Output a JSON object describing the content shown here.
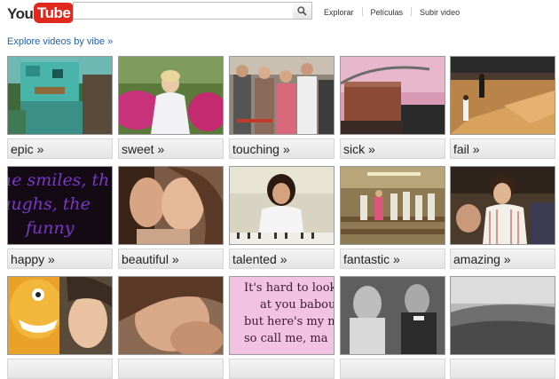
{
  "logo": {
    "you": "You",
    "tube": "Tube"
  },
  "search": {
    "value": "",
    "placeholder": ""
  },
  "nav": {
    "items": [
      "Explorar",
      "Películas",
      "Subir video"
    ]
  },
  "heading": {
    "text": "Explore videos by vibe",
    "chevron": "»"
  },
  "vibes": [
    {
      "label": "epic »"
    },
    {
      "label": "sweet »"
    },
    {
      "label": "touching »"
    },
    {
      "label": "sick »"
    },
    {
      "label": "fail »"
    },
    {
      "label": "happy »"
    },
    {
      "label": "beautiful »"
    },
    {
      "label": "talented »"
    },
    {
      "label": "fantastic »"
    },
    {
      "label": "amazing »"
    },
    {
      "label": ""
    },
    {
      "label": ""
    },
    {
      "label": ""
    },
    {
      "label": ""
    },
    {
      "label": ""
    }
  ],
  "thumb_text": {
    "happy": [
      "he smiles, th",
      "aughs, the",
      "funny"
    ],
    "row3_pink": [
      "It's hard to look",
      "at you babou",
      "but here's my nu",
      "so call me, ma"
    ]
  },
  "colors": {
    "accent_link": "#1c62b9",
    "logo_red": "#e1281c"
  }
}
